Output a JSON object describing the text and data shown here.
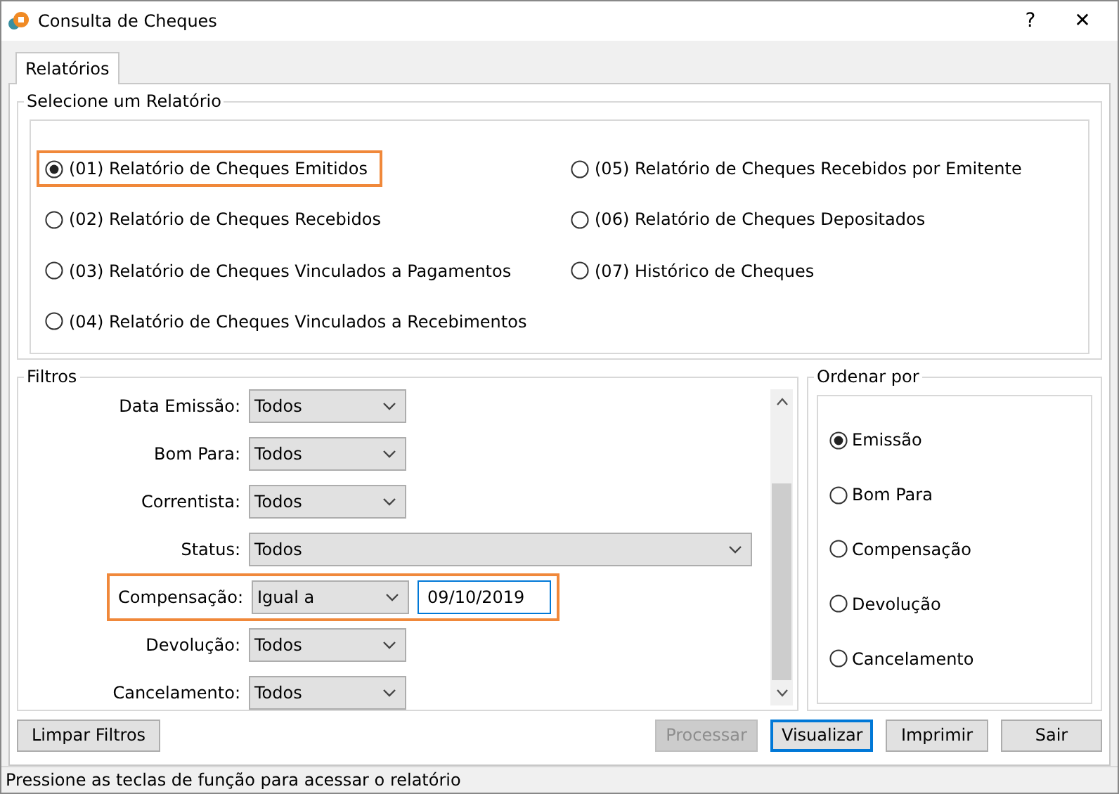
{
  "window": {
    "title": "Consulta de Cheques",
    "buttons": [
      "?",
      "✕"
    ]
  },
  "tabs": [
    {
      "label": "Relatórios",
      "selected": true
    }
  ],
  "report_group": {
    "title": "Selecione um Relatório",
    "options": [
      {
        "label": "(01) Relatório de Cheques Emitidos",
        "selected": true,
        "highlighted": true
      },
      {
        "label": "(02) Relatório de Cheques Recebidos",
        "selected": false,
        "highlighted": false
      },
      {
        "label": "(03) Relatório de Cheques Vinculados a Pagamentos",
        "selected": false,
        "highlighted": false
      },
      {
        "label": "(04) Relatório de Cheques Vinculados a Recebimentos",
        "selected": false,
        "highlighted": false
      },
      {
        "label": "(05) Relatório de Cheques Recebidos por Emitente",
        "selected": false,
        "highlighted": false
      },
      {
        "label": "(06) Relatório de Cheques Depositados",
        "selected": false,
        "highlighted": false
      },
      {
        "label": "(07) Histórico de Cheques",
        "selected": false,
        "highlighted": false
      }
    ]
  },
  "filters": {
    "title": "Filtros",
    "rows": [
      {
        "label": "Data Emissão:",
        "value": "Todos",
        "kind": "combo",
        "highlighted": false
      },
      {
        "label": "Bom Para:",
        "value": "Todos",
        "kind": "combo",
        "highlighted": false
      },
      {
        "label": "Correntista:",
        "value": "Todos",
        "kind": "combo",
        "highlighted": false
      },
      {
        "label": "Status:",
        "value": "Todos",
        "kind": "wide",
        "highlighted": false
      },
      {
        "label": "Compensação:",
        "value": "Igual a",
        "kind": "date",
        "date": "09/10/2019",
        "highlighted": true
      },
      {
        "label": "Devolução:",
        "value": "Todos",
        "kind": "combo",
        "highlighted": false
      },
      {
        "label": "Cancelamento:",
        "value": "Todos",
        "kind": "combo",
        "highlighted": false
      }
    ]
  },
  "order_by": {
    "title": "Ordenar por",
    "options": [
      {
        "label": "Emissão",
        "selected": true
      },
      {
        "label": "Bom Para",
        "selected": false
      },
      {
        "label": "Compensação",
        "selected": false
      },
      {
        "label": "Devolução",
        "selected": false
      },
      {
        "label": "Cancelamento",
        "selected": false
      }
    ]
  },
  "buttons": [
    {
      "label": "Limpar Filtros",
      "disabled": false,
      "focused": false
    },
    {
      "label": "Processar",
      "disabled": true,
      "focused": false
    },
    {
      "label": "Visualizar",
      "disabled": false,
      "focused": true
    },
    {
      "label": "Imprimir",
      "disabled": false,
      "focused": false
    },
    {
      "label": "Sair",
      "disabled": false,
      "focused": false
    }
  ],
  "status_bar": "Pressione as teclas de função para acessar o relatório"
}
